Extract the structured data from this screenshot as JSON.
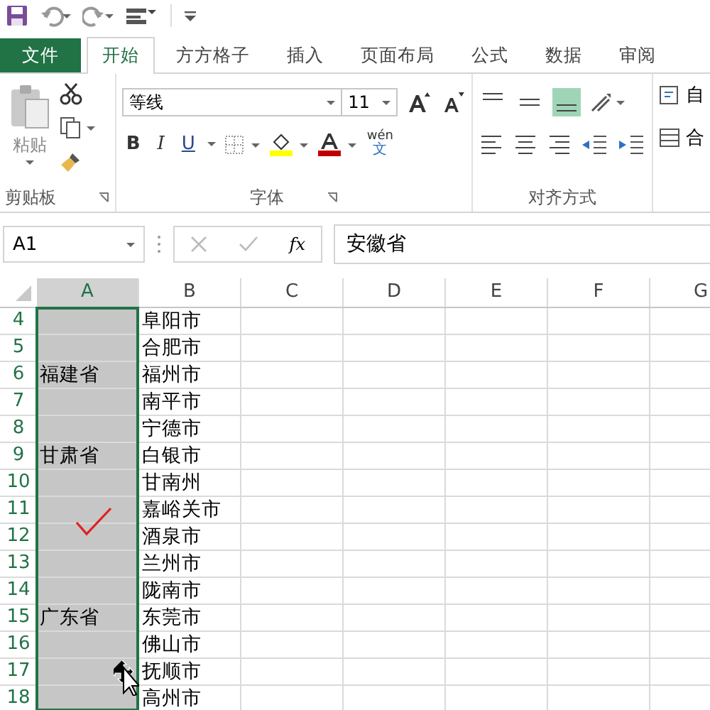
{
  "tabs": [
    {
      "label": "文件",
      "kind": "file",
      "selected": false
    },
    {
      "label": "开始",
      "kind": "tab",
      "selected": true
    },
    {
      "label": "方方格子",
      "kind": "tab",
      "selected": false
    },
    {
      "label": "插入",
      "kind": "tab",
      "selected": false
    },
    {
      "label": "页面布局",
      "kind": "tab",
      "selected": false
    },
    {
      "label": "公式",
      "kind": "tab",
      "selected": false
    },
    {
      "label": "数据",
      "kind": "tab",
      "selected": false
    },
    {
      "label": "审阅",
      "kind": "tab",
      "selected": false
    }
  ],
  "ribbon": {
    "clipboard": {
      "paste": "粘贴",
      "label": "剪贴板"
    },
    "font": {
      "font_name": "等线",
      "font_size": "11",
      "bold": "B",
      "italic": "I",
      "underline": "U",
      "phonetic_top": "wén",
      "phonetic_bottom": "文",
      "label": "字体"
    },
    "alignment": {
      "top_row": [
        {
          "selected": false
        },
        {
          "selected": false
        },
        {
          "selected": true
        }
      ],
      "label": "对齐方式"
    },
    "wrap_text": "自",
    "merge": "合"
  },
  "formula_bar": {
    "name_box": "A1",
    "fx": "fx",
    "value": "安徽省"
  },
  "sheet": {
    "columns": [
      {
        "label": "A",
        "selected": true
      },
      {
        "label": "B",
        "selected": false
      },
      {
        "label": "C",
        "selected": false
      },
      {
        "label": "D",
        "selected": false
      },
      {
        "label": "E",
        "selected": false
      },
      {
        "label": "F",
        "selected": false
      },
      {
        "label": "G",
        "selected": false
      }
    ],
    "rows": [
      {
        "number": "4",
        "a": "",
        "b": "阜阳市"
      },
      {
        "number": "5",
        "a": "",
        "b": "合肥市"
      },
      {
        "number": "6",
        "a": "福建省",
        "b": "福州市"
      },
      {
        "number": "7",
        "a": "",
        "b": "南平市"
      },
      {
        "number": "8",
        "a": "",
        "b": "宁德市"
      },
      {
        "number": "9",
        "a": "甘肃省",
        "b": "白银市"
      },
      {
        "number": "10",
        "a": "",
        "b": "甘南州"
      },
      {
        "number": "11",
        "a": "",
        "b": "嘉峪关市"
      },
      {
        "number": "12",
        "a": "",
        "b": "酒泉市"
      },
      {
        "number": "13",
        "a": "",
        "b": "兰州市"
      },
      {
        "number": "14",
        "a": "",
        "b": "陇南市"
      },
      {
        "number": "15",
        "a": "广东省",
        "b": "东莞市"
      },
      {
        "number": "16",
        "a": "",
        "b": "佛山市"
      },
      {
        "number": "17",
        "a": "",
        "b": "抚顺市"
      },
      {
        "number": "18",
        "a": "",
        "b": "高州市"
      }
    ]
  }
}
